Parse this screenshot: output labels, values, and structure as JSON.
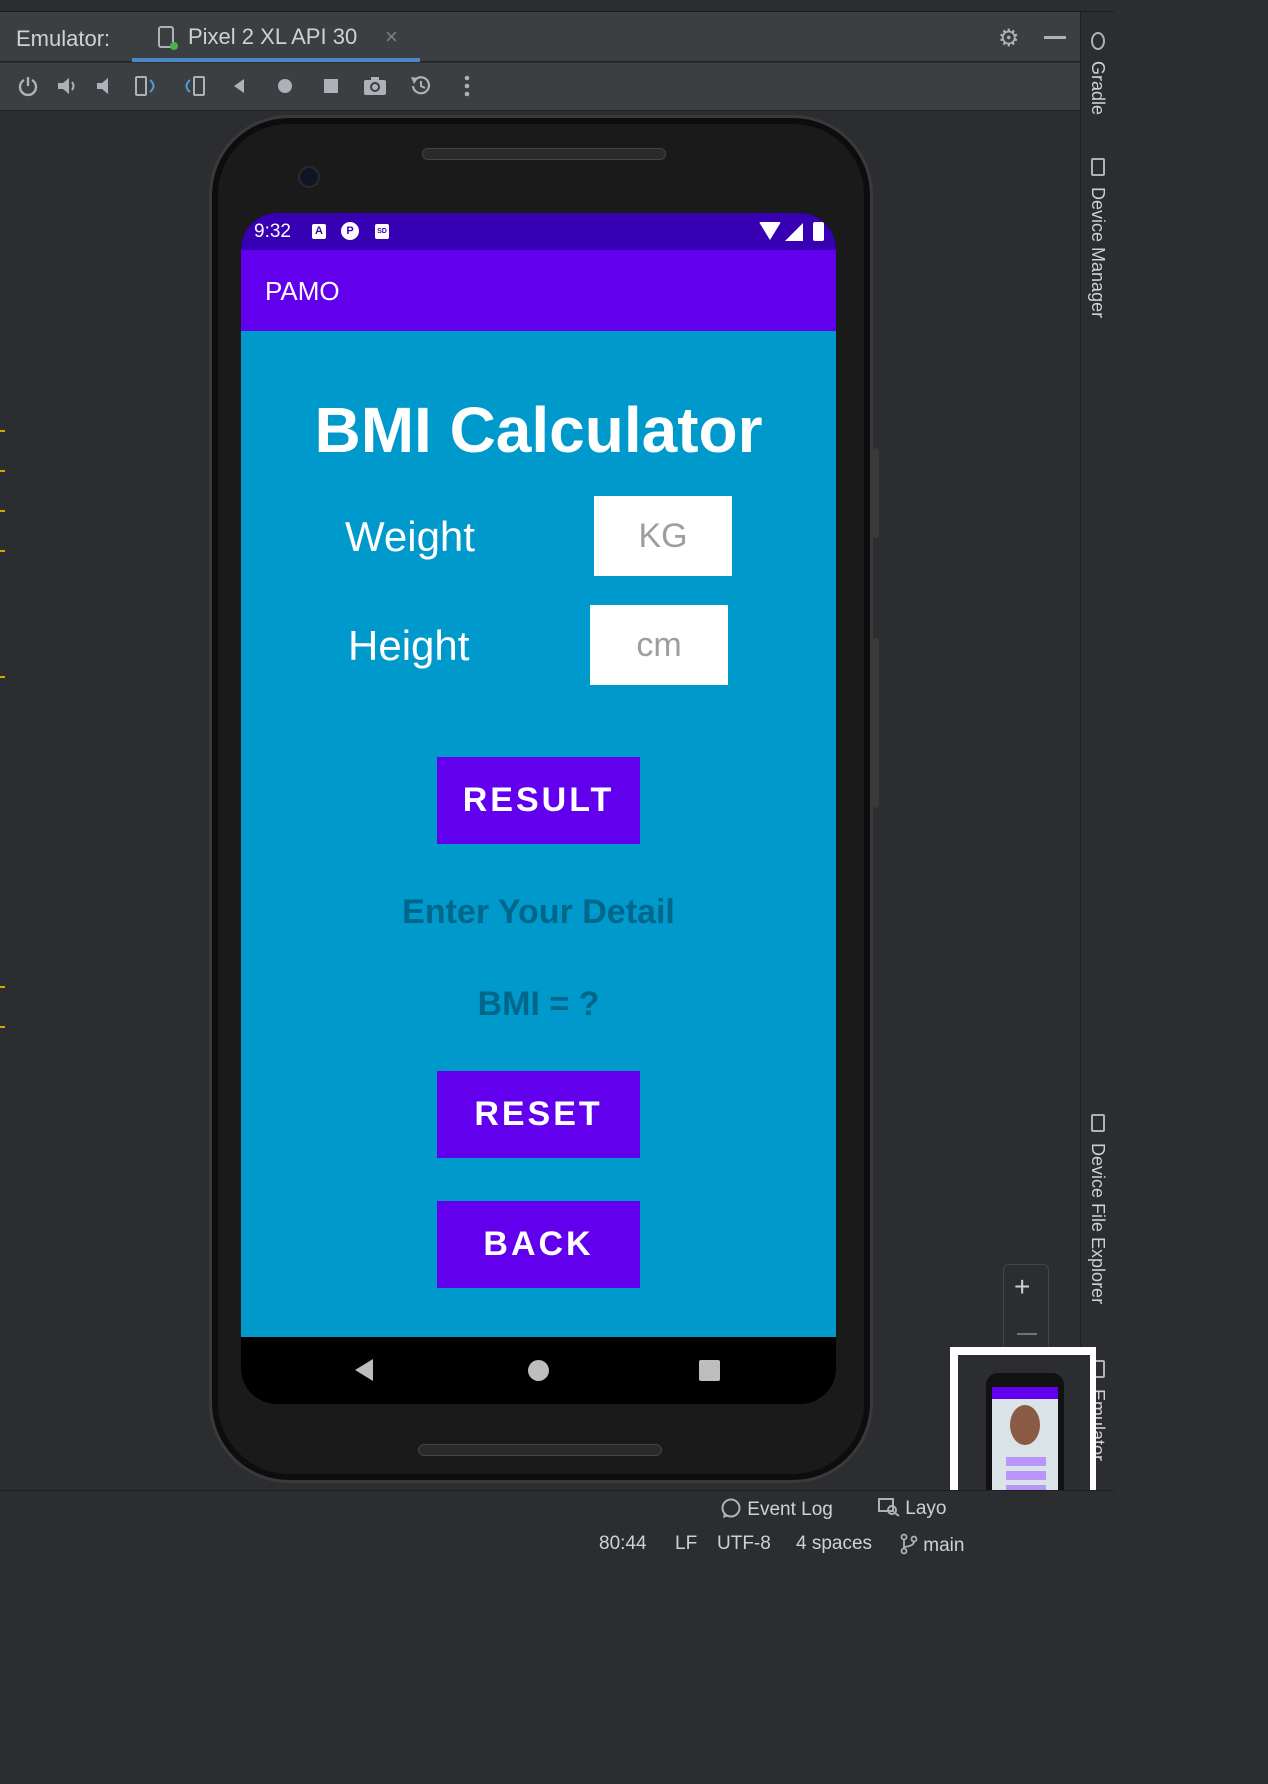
{
  "emulator": {
    "label": "Emulator:",
    "device_tab": "Pixel 2 XL API 30",
    "close_glyph": "×"
  },
  "toolbar": {
    "icons": [
      "power-icon",
      "volume-up-icon",
      "volume-down-icon",
      "rotate-left-icon",
      "rotate-right-icon",
      "back-icon",
      "home-icon",
      "overview-icon",
      "camera-icon",
      "snapshot-icon",
      "more-icon"
    ]
  },
  "right_tabs": {
    "gradle": "Gradle",
    "device_manager": "Device Manager",
    "device_file_explorer": "Device File Explorer",
    "emulator": "Emulator"
  },
  "phone": {
    "status": {
      "time": "9:32",
      "notif_icons": [
        "A",
        "P",
        "SD"
      ]
    },
    "appbar": {
      "title": "PAMO"
    },
    "screen": {
      "heading": "BMI Calculator",
      "weight_label": "Weight",
      "weight_placeholder": "KG",
      "height_label": "Height",
      "height_placeholder": "cm",
      "result_button": "RESULT",
      "info_text": "Enter Your Detail",
      "bmi_text": "BMI = ?",
      "reset_button": "RESET",
      "back_button": "BACK"
    }
  },
  "zoom": {
    "plus": "+"
  },
  "statusbar": {
    "event_log": "Event Log",
    "layout": "Layo",
    "position": "80:44",
    "line_ending": "LF",
    "encoding": "UTF-8",
    "indent": "4 spaces",
    "branch": "main"
  },
  "colors": {
    "status_bar": "#3700b3",
    "app_bar": "#6200ee",
    "content_bg": "#0099cc",
    "button": "#6200ee",
    "info_text": "#00668a"
  }
}
